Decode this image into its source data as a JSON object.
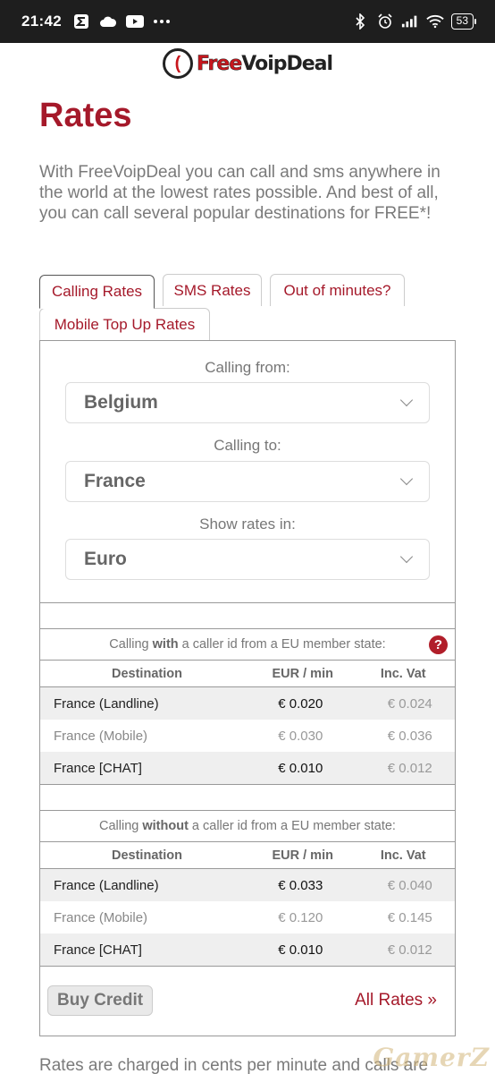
{
  "status_bar": {
    "time": "21:42",
    "battery": "53",
    "left_icons": [
      "sigma-icon",
      "cloud-icon",
      "youtube-icon",
      "more-dots-icon"
    ],
    "right_icons": [
      "bluetooth-icon",
      "alarm-icon",
      "signal-icon",
      "wifi-icon",
      "battery-icon"
    ]
  },
  "logo": {
    "free": "Free",
    "rest": "VoipDeal"
  },
  "page_title": "Rates",
  "intro": "With FreeVoipDeal you can call and sms anywhere in the world at the lowest rates possible. And best of all, you can call several popular destinations for FREE*!",
  "tabs": [
    {
      "label": "Calling Rates"
    },
    {
      "label": "SMS Rates"
    },
    {
      "label": "Out of minutes?"
    },
    {
      "label": "Mobile Top Up Rates"
    }
  ],
  "form": {
    "from_label": "Calling from:",
    "from_value": "Belgium",
    "to_label": "Calling to:",
    "to_value": "France",
    "currency_label": "Show rates in:",
    "currency_value": "Euro"
  },
  "table_with": {
    "caption_pre": "Calling",
    "caption_bold": "with",
    "caption_post": "a caller id from a EU member state:",
    "help": "?",
    "headers": [
      "Destination",
      "EUR / min",
      "Inc. Vat"
    ],
    "rows": [
      {
        "dest": "France (Landline)",
        "rate": "€ 0.020",
        "vat": "€ 0.024"
      },
      {
        "dest": "France (Mobile)",
        "rate": "€ 0.030",
        "vat": "€ 0.036"
      },
      {
        "dest": "France [CHAT]",
        "rate": "€ 0.010",
        "vat": "€ 0.012"
      }
    ]
  },
  "table_without": {
    "caption_pre": "Calling",
    "caption_bold": "without",
    "caption_post": "a caller id from a EU member state:",
    "headers": [
      "Destination",
      "EUR / min",
      "Inc. Vat"
    ],
    "rows": [
      {
        "dest": "France (Landline)",
        "rate": "€ 0.033",
        "vat": "€ 0.040"
      },
      {
        "dest": "France (Mobile)",
        "rate": "€ 0.120",
        "vat": "€ 0.145"
      },
      {
        "dest": "France [CHAT]",
        "rate": "€ 0.010",
        "vat": "€ 0.012"
      }
    ]
  },
  "buy_credit": "Buy Credit",
  "all_rates": "All Rates »",
  "footer_text": "Rates are charged in cents per minute and calls are",
  "watermark": "GamerZ",
  "colors": {
    "accent": "#a5192a",
    "status_bar": "#1e1e1e"
  }
}
